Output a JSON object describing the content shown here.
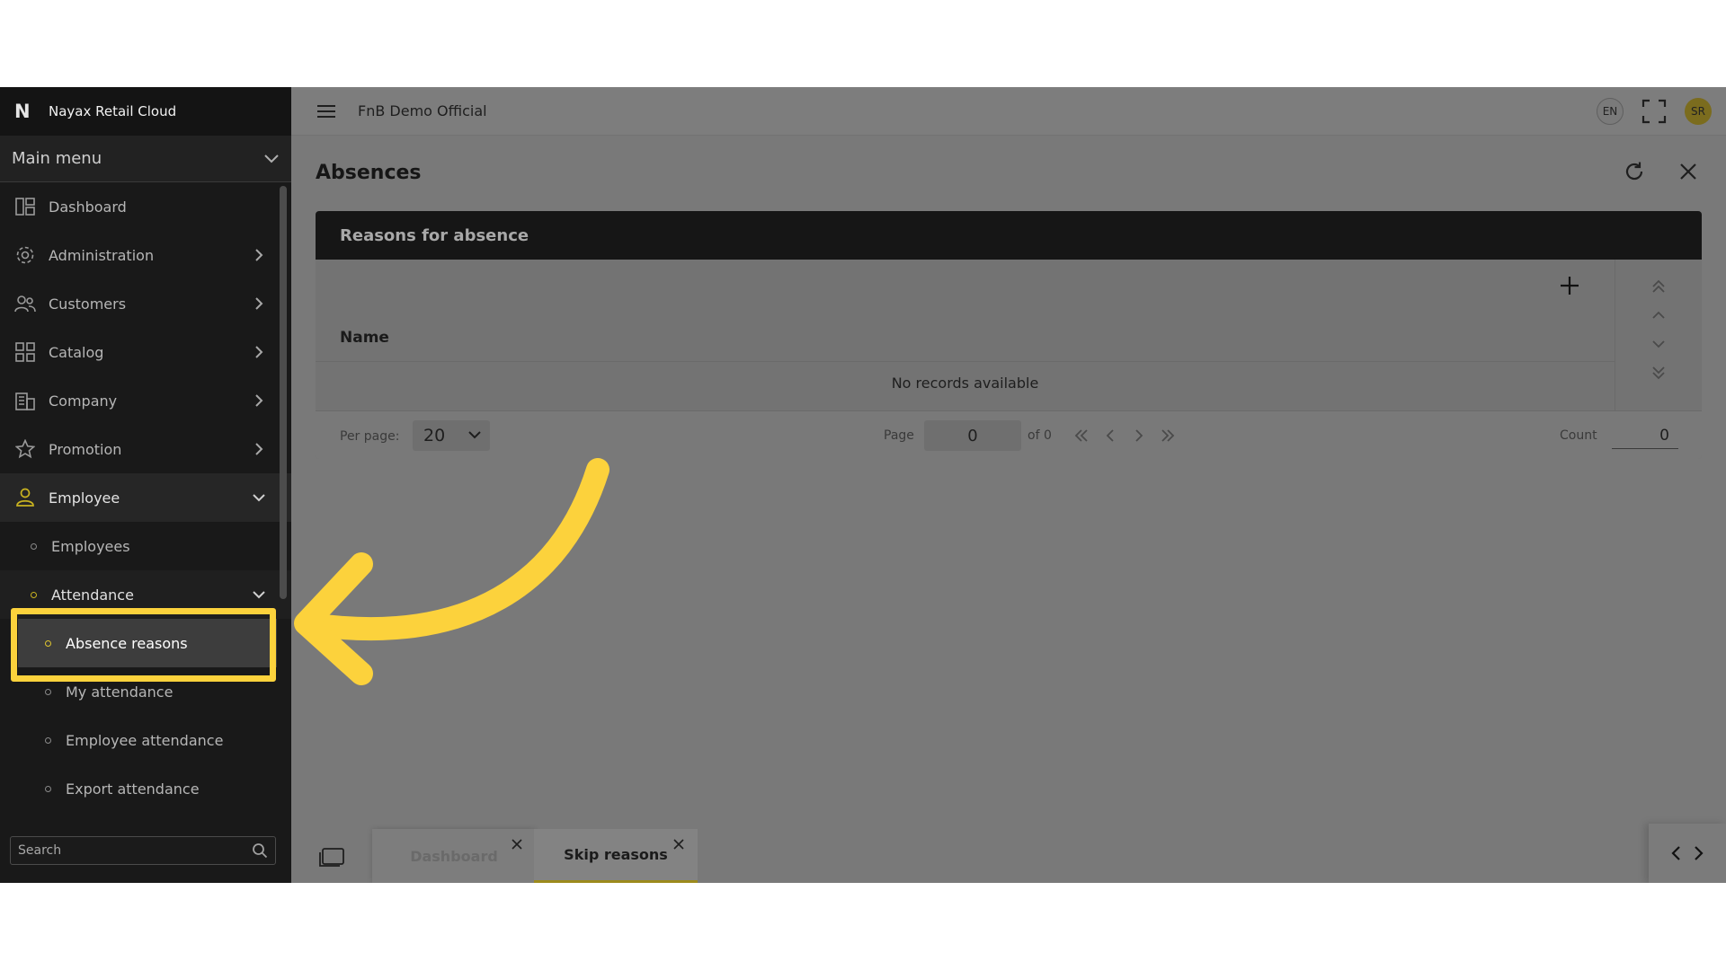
{
  "brand": {
    "name": "Nayax Retail Cloud",
    "logo": "N"
  },
  "sidebar": {
    "main_menu_label": "Main menu",
    "items": [
      {
        "label": "Dashboard",
        "icon": "dashboard-icon"
      },
      {
        "label": "Administration",
        "icon": "gear-icon"
      },
      {
        "label": "Customers",
        "icon": "users-icon"
      },
      {
        "label": "Catalog",
        "icon": "grid-icon"
      },
      {
        "label": "Company",
        "icon": "building-icon"
      },
      {
        "label": "Promotion",
        "icon": "star-icon"
      },
      {
        "label": "Employee",
        "icon": "employee-icon"
      }
    ],
    "employee_sub": [
      "Employees",
      "Attendance"
    ],
    "attendance_sub": [
      "Absence reasons",
      "My attendance",
      "Employee attendance",
      "Export attendance"
    ],
    "search_placeholder": "Search"
  },
  "header": {
    "org_name": "FnB Demo Official",
    "language": "EN",
    "avatar_initials": "SR"
  },
  "page": {
    "title": "Absences",
    "card_title": "Reasons for absence",
    "column_name": "Name",
    "empty_text": "No records available"
  },
  "pager": {
    "per_page_label": "Per page:",
    "per_page_value": "20",
    "page_label": "Page",
    "page_value": "0",
    "of_label": "of 0",
    "count_label": "Count",
    "count_value": "0"
  },
  "tabs": [
    {
      "label": "Dashboard"
    },
    {
      "label": "Skip reasons"
    }
  ],
  "colors": {
    "highlight": "#fcd23c",
    "accent": "#c9b320"
  }
}
